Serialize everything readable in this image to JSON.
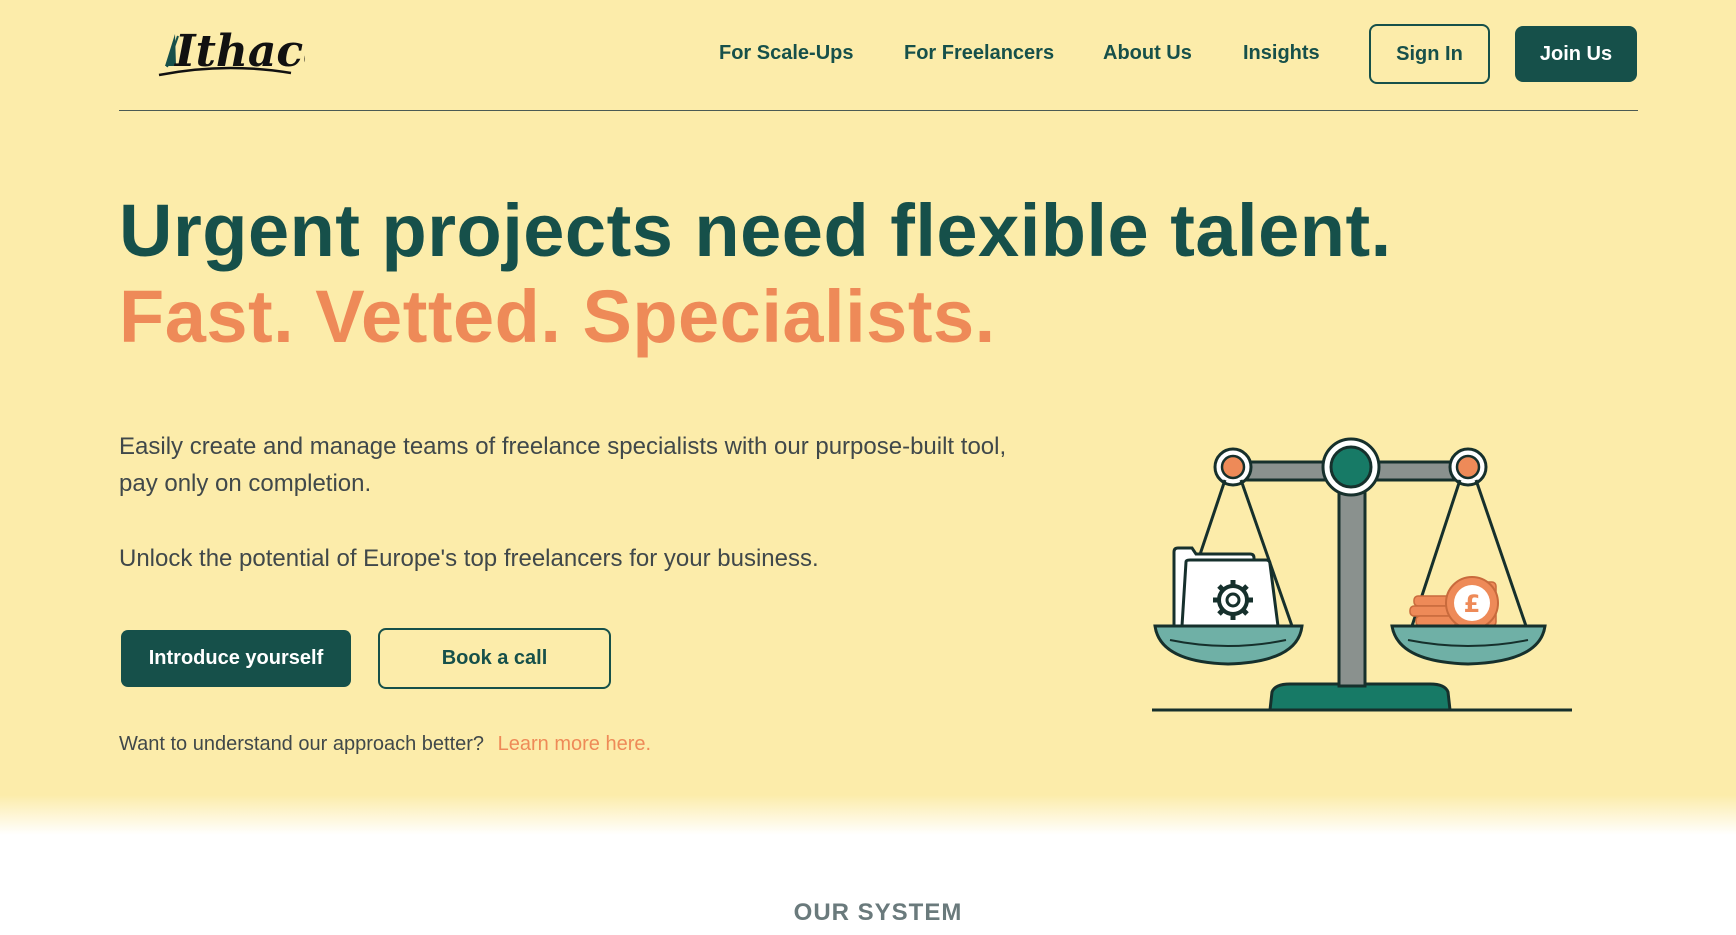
{
  "brand": {
    "logo_text": "Ithaca",
    "logo_icon": "sail-icon"
  },
  "nav": {
    "links": [
      {
        "label": "For Scale-Ups"
      },
      {
        "label": "For Freelancers"
      },
      {
        "label": "About Us"
      },
      {
        "label": "Insights"
      }
    ],
    "sign_in_label": "Sign In",
    "join_label": "Join Us"
  },
  "hero": {
    "headline": "Urgent projects need flexible talent.",
    "subheadline": "Fast. Vetted. Specialists.",
    "paragraph_1": "Easily create and manage teams of freelance specialists with our purpose-built tool, pay only on completion.",
    "paragraph_2": "Unlock the potential of Europe's top freelancers for your business.",
    "primary_cta": "Introduce yourself",
    "secondary_cta": "Book a call",
    "learn_prompt": "Want to understand our approach better?",
    "learn_link": "Learn more here."
  },
  "illustration": {
    "name": "balance-scale-icon",
    "left_pan_item": "gear-folder-icon",
    "right_pan_item": "pound-coins-icon",
    "currency_symbol": "£"
  },
  "section": {
    "label": "OUR SYSTEM"
  },
  "colors": {
    "hero_bg": "#fcecaa",
    "primary": "#16504a",
    "accent": "#ee8a58",
    "body_text": "#40484a",
    "muted": "#6a7a7c"
  }
}
